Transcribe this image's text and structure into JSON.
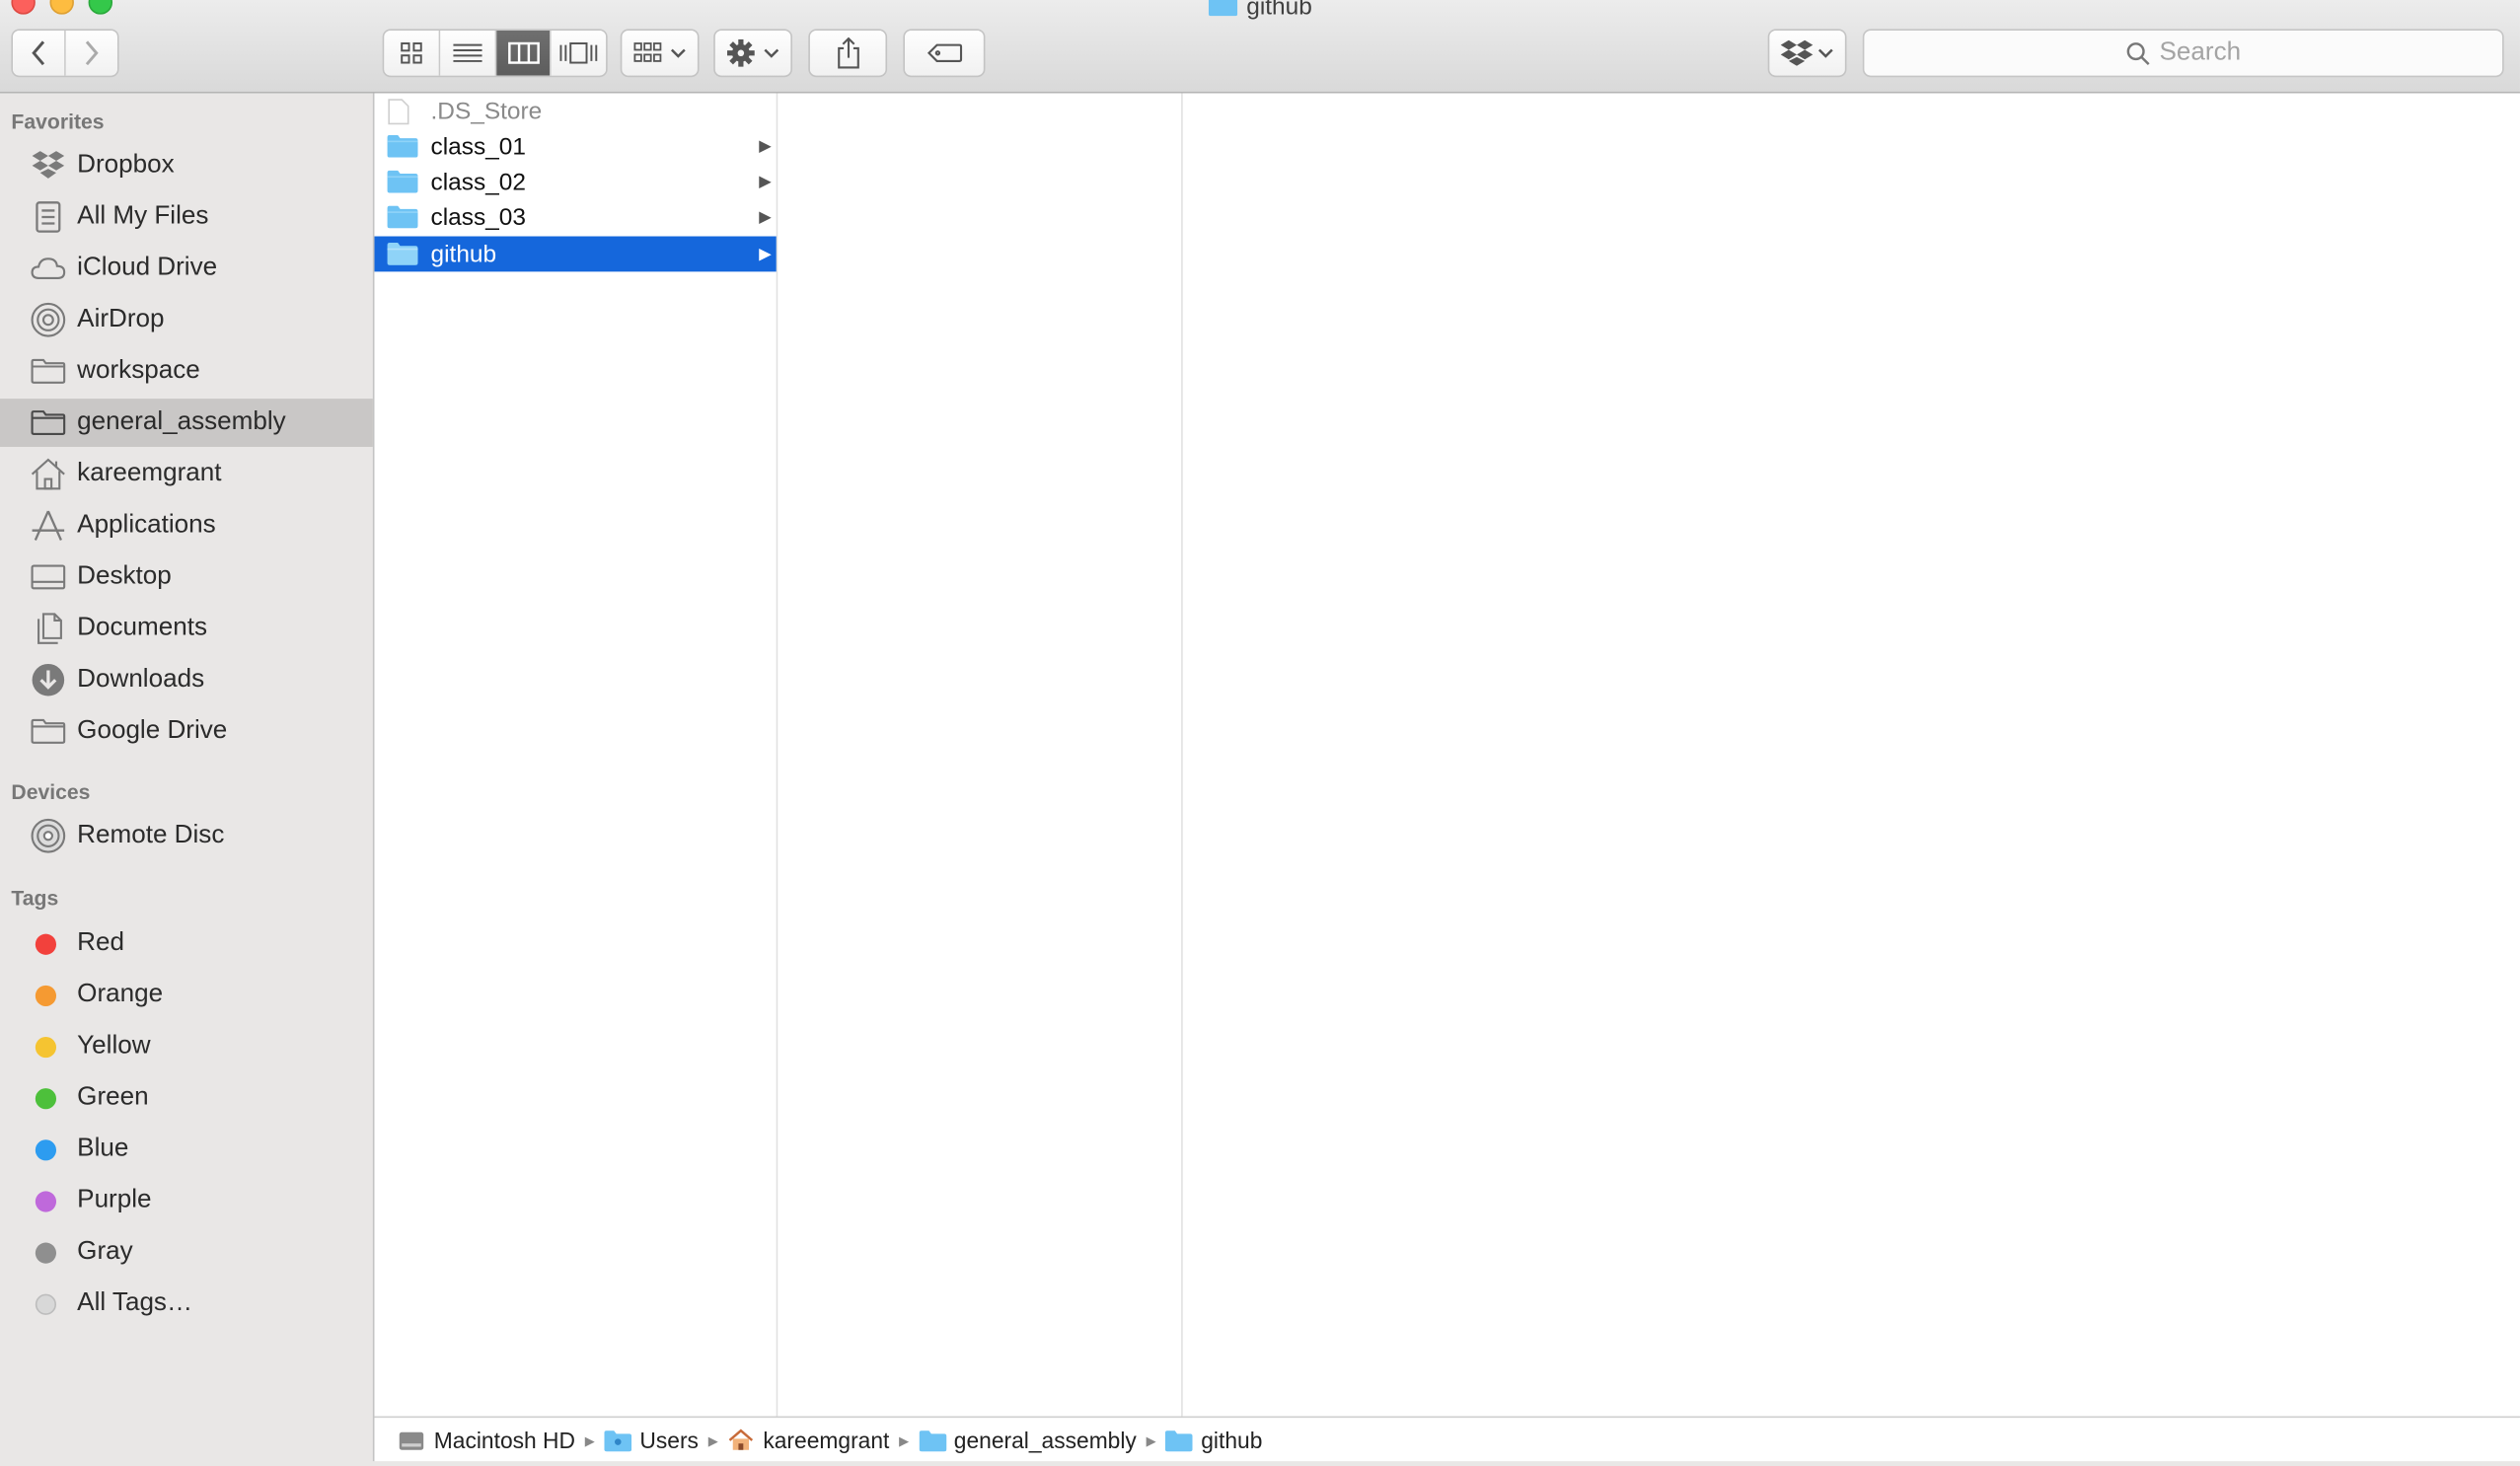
{
  "window": {
    "title": "github"
  },
  "search": {
    "placeholder": "Search"
  },
  "sidebar": {
    "favorites_header": "Favorites",
    "devices_header": "Devices",
    "tags_header": "Tags",
    "favorites": [
      {
        "label": "Dropbox",
        "icon": "dropbox-icon"
      },
      {
        "label": "All My Files",
        "icon": "all-files-icon"
      },
      {
        "label": "iCloud Drive",
        "icon": "cloud-icon"
      },
      {
        "label": "AirDrop",
        "icon": "airdrop-icon"
      },
      {
        "label": "workspace",
        "icon": "folder-icon"
      },
      {
        "label": "general_assembly",
        "icon": "folder-icon"
      },
      {
        "label": "kareemgrant",
        "icon": "home-icon"
      },
      {
        "label": "Applications",
        "icon": "applications-icon"
      },
      {
        "label": "Desktop",
        "icon": "desktop-icon"
      },
      {
        "label": "Documents",
        "icon": "documents-icon"
      },
      {
        "label": "Downloads",
        "icon": "downloads-icon"
      },
      {
        "label": "Google Drive",
        "icon": "folder-icon"
      }
    ],
    "selected_favorite": "general_assembly",
    "devices": [
      {
        "label": "Remote Disc",
        "icon": "disc-icon"
      }
    ],
    "tags": [
      {
        "label": "Red",
        "color": "#f2413c"
      },
      {
        "label": "Orange",
        "color": "#f59a32"
      },
      {
        "label": "Yellow",
        "color": "#f5c431"
      },
      {
        "label": "Green",
        "color": "#4dc03b"
      },
      {
        "label": "Blue",
        "color": "#2d9cf0"
      },
      {
        "label": "Purple",
        "color": "#bf69db"
      },
      {
        "label": "Gray",
        "color": "#8f8f8f"
      },
      {
        "label": "All Tags…",
        "color": "#d8d8d8"
      }
    ]
  },
  "files": [
    {
      "name": ".DS_Store",
      "type": "file"
    },
    {
      "name": "class_01",
      "type": "folder"
    },
    {
      "name": "class_02",
      "type": "folder"
    },
    {
      "name": "class_03",
      "type": "folder"
    },
    {
      "name": "github",
      "type": "folder",
      "selected": true
    }
  ],
  "pathbar": [
    {
      "label": "Macintosh HD",
      "icon": "hard-drive-icon"
    },
    {
      "label": "Users",
      "icon": "users-folder-icon"
    },
    {
      "label": "kareemgrant",
      "icon": "home-icon"
    },
    {
      "label": "general_assembly",
      "icon": "folder-icon"
    },
    {
      "label": "github",
      "icon": "folder-icon"
    }
  ],
  "colors": {
    "selection": "#1567dc",
    "folder": "#6ec3f4",
    "sidebar_bg": "#e9e7e6"
  }
}
